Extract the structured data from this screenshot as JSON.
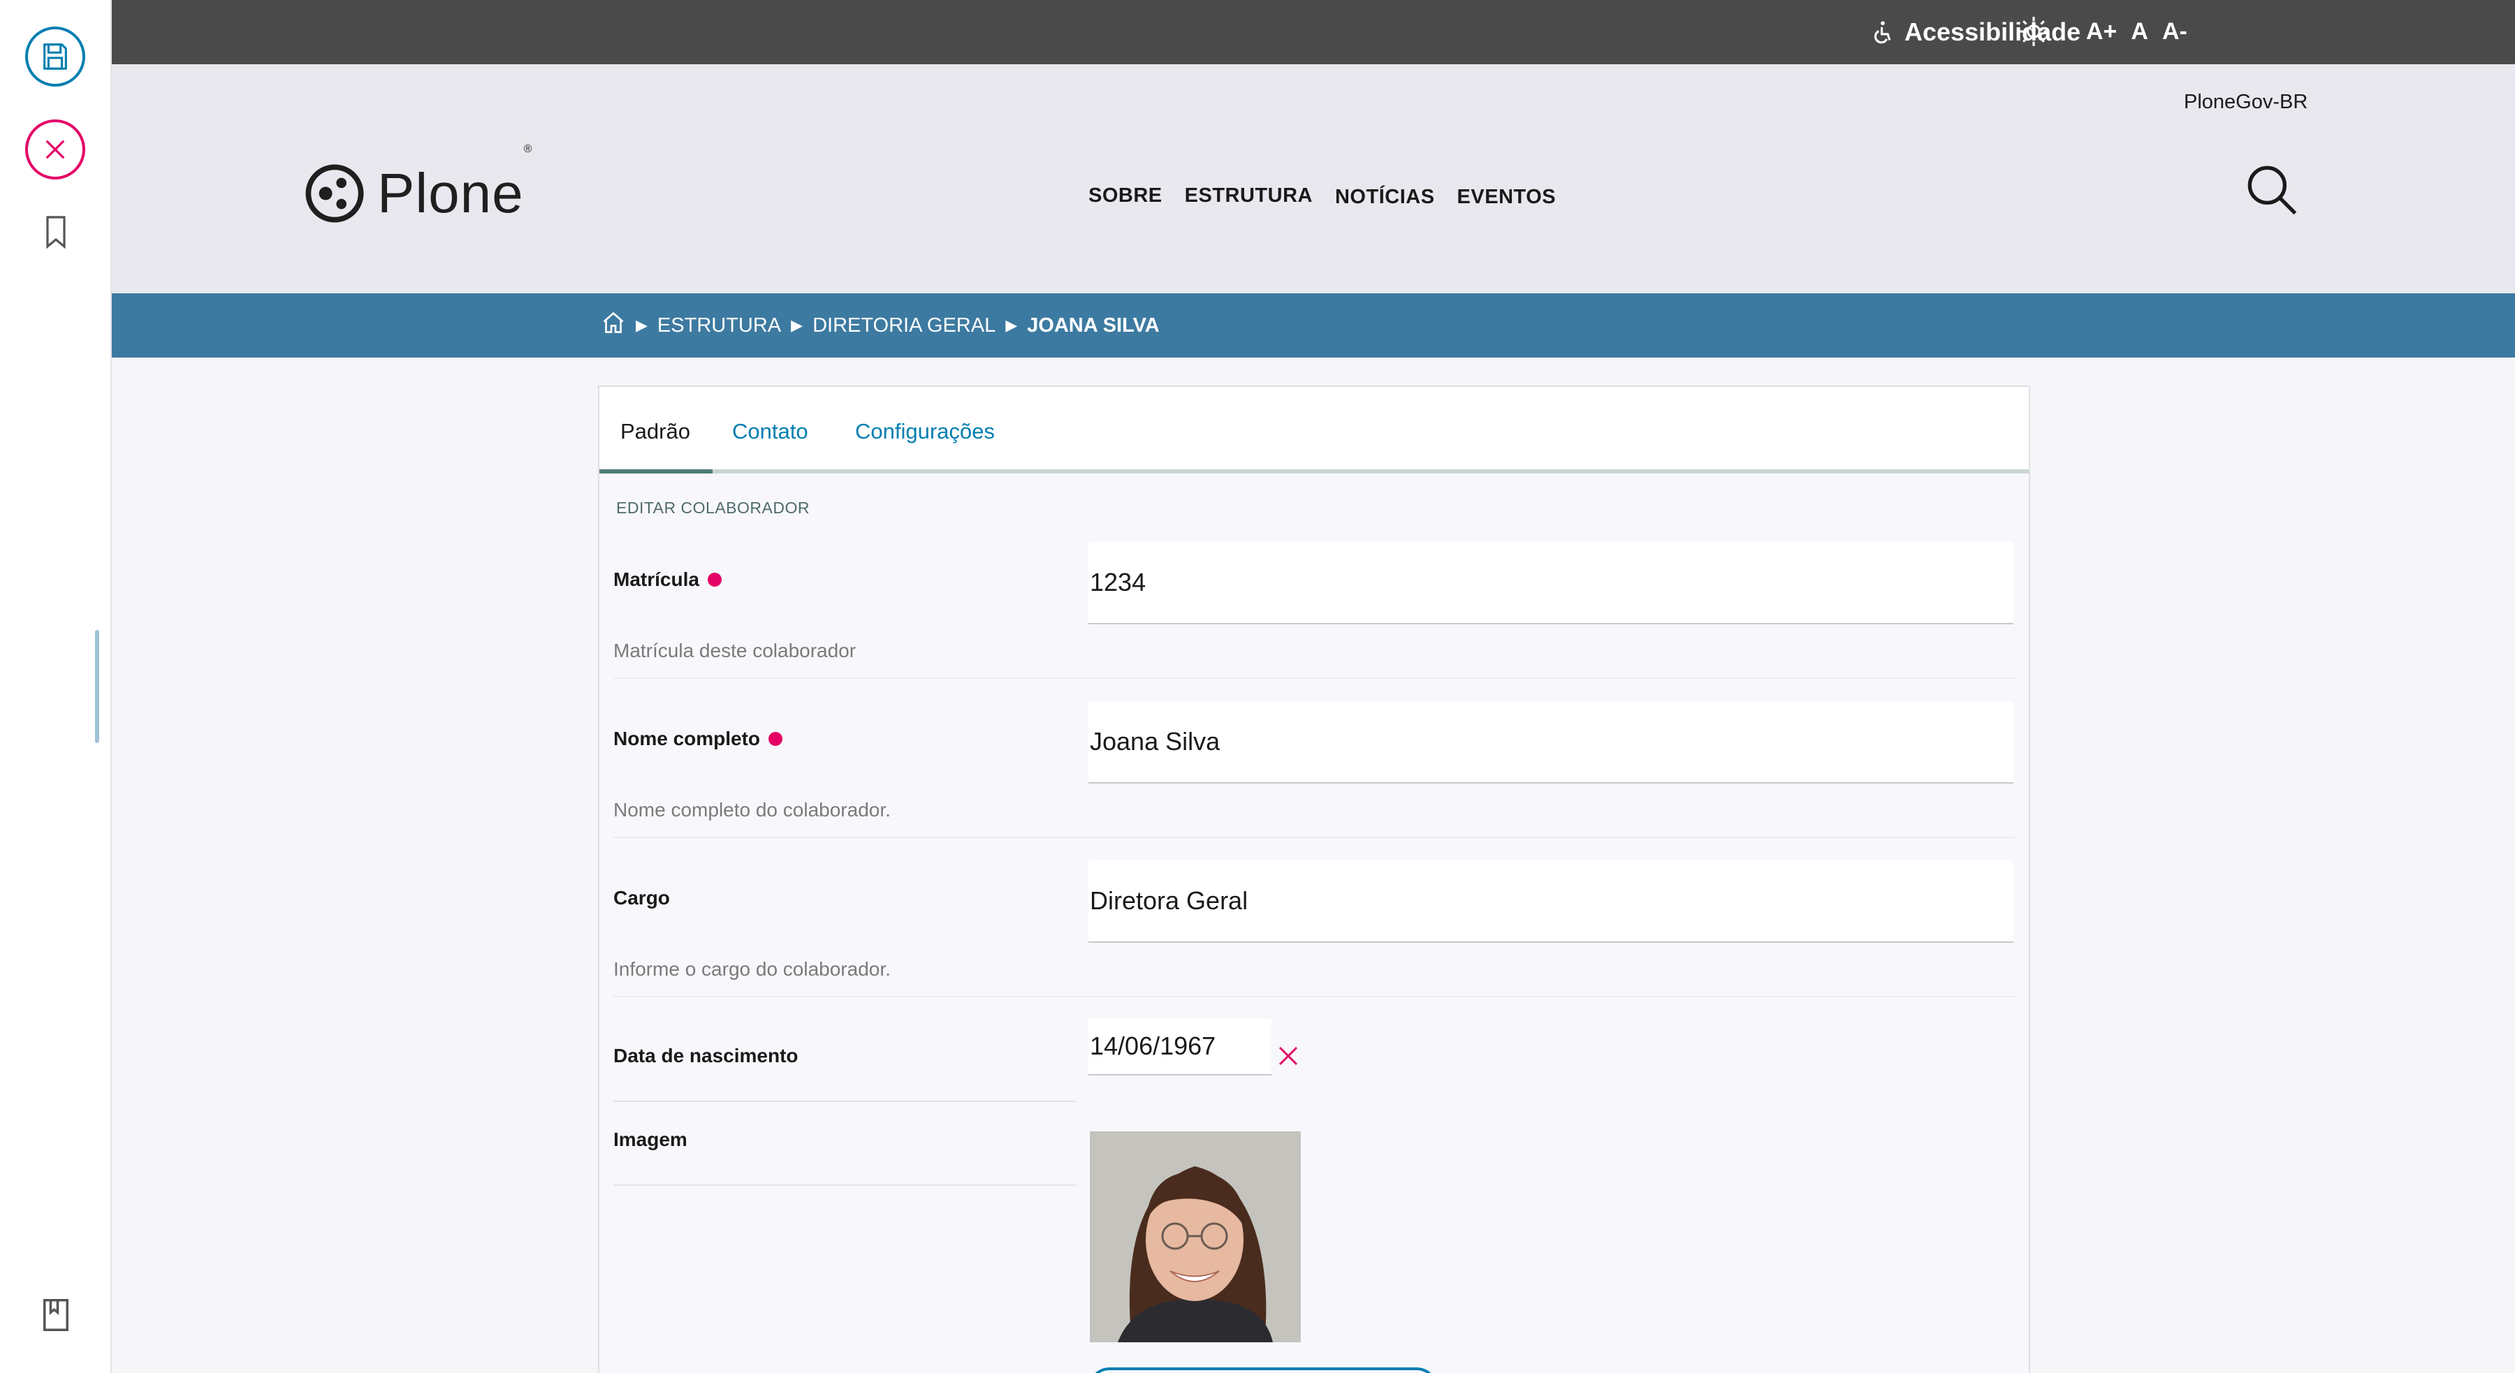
{
  "toolbar": {
    "save_icon": "save-icon",
    "cancel_icon": "close-icon",
    "bookmark_icon": "bookmark-icon",
    "bottom_icon": "book-icon",
    "accent_save": "#007eb1",
    "accent_cancel": "#e40166"
  },
  "topbar": {
    "accessibility_label": "Acessibilidade",
    "font_increase": "A+",
    "font_normal": "A",
    "font_decrease": "A-"
  },
  "header": {
    "site_name": "PloneGov-BR",
    "logo_text": "Plone",
    "logo_reg": "®",
    "nav": [
      "SOBRE",
      "ESTRUTURA",
      "NOTÍCIAS",
      "EVENTOS"
    ]
  },
  "breadcrumb": {
    "items": [
      "ESTRUTURA",
      "DIRETORIA GERAL"
    ],
    "current": "JOANA SILVA"
  },
  "form": {
    "tabs": [
      "Padrão",
      "Contato",
      "Configurações"
    ],
    "active_tab": "Padrão",
    "section_title": "EDITAR COLABORADOR",
    "fields": {
      "matricula": {
        "label": "Matrícula",
        "value": "1234",
        "help": "Matrícula deste colaborador",
        "required": true
      },
      "nome": {
        "label": "Nome completo",
        "value": "Joana Silva",
        "help": "Nome completo do colaborador.",
        "required": true
      },
      "cargo": {
        "label": "Cargo",
        "value": "Diretora Geral",
        "help": "Informe o cargo do colaborador.",
        "required": false
      },
      "nascimento": {
        "label": "Data de nascimento",
        "value": "14/06/1967"
      },
      "imagem": {
        "label": "Imagem"
      }
    }
  }
}
